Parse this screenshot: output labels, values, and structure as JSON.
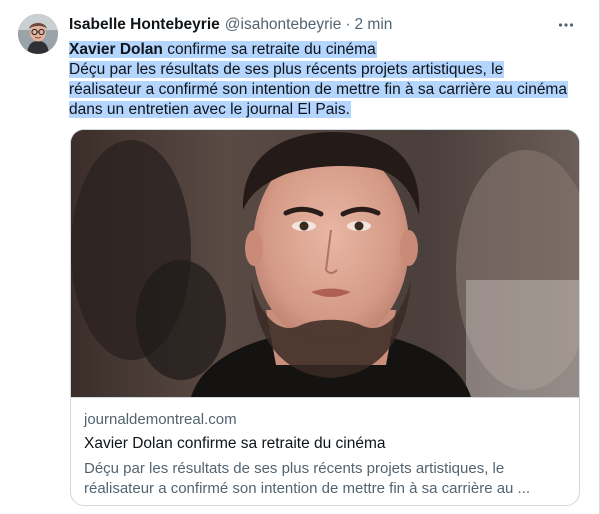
{
  "tweet": {
    "author": {
      "display_name": "Isabelle Hontebeyrie",
      "handle": "@isahontebeyrie",
      "avatar_icon": "person-avatar"
    },
    "separator": "·",
    "time": "2 min",
    "more_icon": "ellipsis-icon",
    "text": {
      "title": "Xavier Dolan",
      "title_rest": " confirme sa retraite du cinéma",
      "line2": "Déçu par les résultats de ses plus récents projets artistiques, le",
      "line3": "réalisateur a confirmé son intention de mettre fin à sa carrière au  cinéma",
      "line4": "dans un entretien avec le journal El Pais."
    },
    "card": {
      "image_icon": "portrait-photo",
      "domain": "journaldemontreal.com",
      "title": "Xavier Dolan confirme sa retraite du cinéma",
      "description_line1": "Déçu par les résultats de ses plus récents projets artistiques, le",
      "description_line2": "réalisateur a confirmé son intention de mettre fin à sa carrière au ..."
    }
  },
  "colors": {
    "highlight": "#b4d5fe",
    "secondary_text": "#536471",
    "primary_text": "#0f1419",
    "border": "#cfd9de"
  }
}
